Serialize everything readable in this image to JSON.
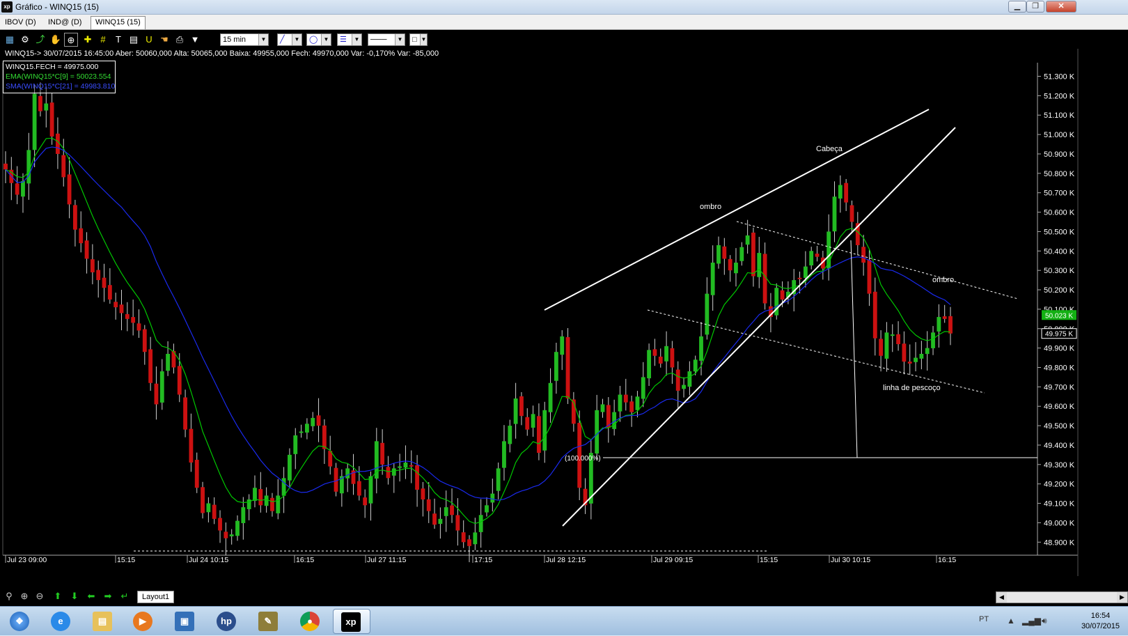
{
  "window": {
    "title": "Gráfico - WINQ15 (15)",
    "app_icon": "xp",
    "minimize": "▁",
    "maximize": "❐",
    "close": "✕"
  },
  "tabs": [
    {
      "label": "IBOV (D)",
      "active": false
    },
    {
      "label": "IND@ (D)",
      "active": false
    },
    {
      "label": "WINQ15 (15)",
      "active": true
    }
  ],
  "toolbar": {
    "period": "15 min",
    "icons": [
      "chart-type-icon",
      "settings-icon",
      "trend-icon",
      "hand-icon",
      "zoom-area-icon",
      "crosshair-icon",
      "grid-icon",
      "text-icon",
      "calculator-icon",
      "magnet-icon",
      "hand2-icon",
      "print-icon",
      "filter-icon"
    ]
  },
  "info_line": "WINQ15-> 30/07/2015 16:45:00 Aber: 50060,000 Alta: 50065,000 Baixa: 49955,000 Fech: 49970,000 Var: -0,170% Var: -85,000",
  "legend": [
    {
      "text": "WINQ15.FECH = 49975.000",
      "color": "#ffffff"
    },
    {
      "text": "EMA(WINQ15*C[9] = 50023.554",
      "color": "#33dd33"
    },
    {
      "text": "SMA(WINQ15*C[21] = 49983.810",
      "color": "#3a4dff"
    }
  ],
  "colors": {
    "up": "#22bb22",
    "down": "#cc1111",
    "ema": "#00c800",
    "sma": "#1a2aee"
  },
  "chart_data": {
    "type": "candlestick",
    "symbol": "WINQ15",
    "interval": "15 min",
    "y_ticks": [
      "51.300 K",
      "51.200 K",
      "51.100 K",
      "51.000 K",
      "50.900 K",
      "50.800 K",
      "50.700 K",
      "50.600 K",
      "50.500 K",
      "50.400 K",
      "50.300 K",
      "50.200 K",
      "50.100 K",
      "50.000 K",
      "49.900 K",
      "49.800 K",
      "49.700 K",
      "49.600 K",
      "49.500 K",
      "49.400 K",
      "49.300 K",
      "49.200 K",
      "49.100 K",
      "49.000 K",
      "48.900 K"
    ],
    "y_range": [
      48840,
      51370
    ],
    "x_ticks": [
      "Jul 23 09:00",
      "15:15",
      "Jul 24 10:15",
      "16:15",
      "Jul 27 11:15",
      "17:15",
      "Jul 28 12:15",
      "Jul 29 09:15",
      "15:15",
      "Jul 30 10:15",
      "16:15"
    ],
    "last_price_label": "49.975 K",
    "ema_label": "50.023 K",
    "level_label": "(100.000%)",
    "level_value": 49300,
    "annotations": [
      "ombro",
      "Cabeça",
      "ombro",
      "linha de pescoço"
    ],
    "closes": [
      50820,
      50750,
      50690,
      50760,
      50920,
      51210,
      51120,
      51160,
      50990,
      50900,
      50780,
      50640,
      50510,
      50440,
      50360,
      50290,
      50250,
      50210,
      50150,
      50110,
      50080,
      50050,
      50030,
      49990,
      49880,
      49720,
      49610,
      49780,
      49870,
      49800,
      49660,
      49480,
      49310,
      49180,
      49050,
      49100,
      49020,
      48960,
      48920,
      48940,
      49010,
      49080,
      49120,
      49180,
      49090,
      49140,
      49060,
      49140,
      49230,
      49350,
      49450,
      49470,
      49510,
      49540,
      49500,
      49380,
      49290,
      49160,
      49240,
      49280,
      49200,
      49140,
      49090,
      49240,
      49420,
      49300,
      49230,
      49280,
      49290,
      49310,
      49290,
      49170,
      49120,
      49060,
      48990,
      49020,
      49080,
      49040,
      48960,
      48900,
      48880,
      48950,
      49040,
      49090,
      49150,
      49280,
      49420,
      49500,
      49640,
      49550,
      49480,
      49560,
      49360,
      49580,
      49720,
      49880,
      49960,
      49640,
      49510,
      49180,
      49090,
      49360,
      49580,
      49610,
      49490,
      49570,
      49660,
      49620,
      49570,
      49650,
      49750,
      49890,
      49860,
      49820,
      49910,
      49800,
      49680,
      49710,
      49780,
      49840,
      49960,
      50180,
      50340,
      50430,
      50360,
      50300,
      50340,
      50420,
      50480,
      50270,
      50390,
      50130,
      50060,
      50210,
      50150,
      50190,
      50250,
      50260,
      50320,
      50400,
      50370,
      50310,
      50500,
      50680,
      50740,
      50650,
      50550,
      50430,
      50340,
      50180,
      49950,
      49860,
      49980,
      49970,
      49920,
      49830,
      49820,
      49850,
      49870,
      49900,
      49980,
      50060,
      50050,
      49975
    ]
  }
}
